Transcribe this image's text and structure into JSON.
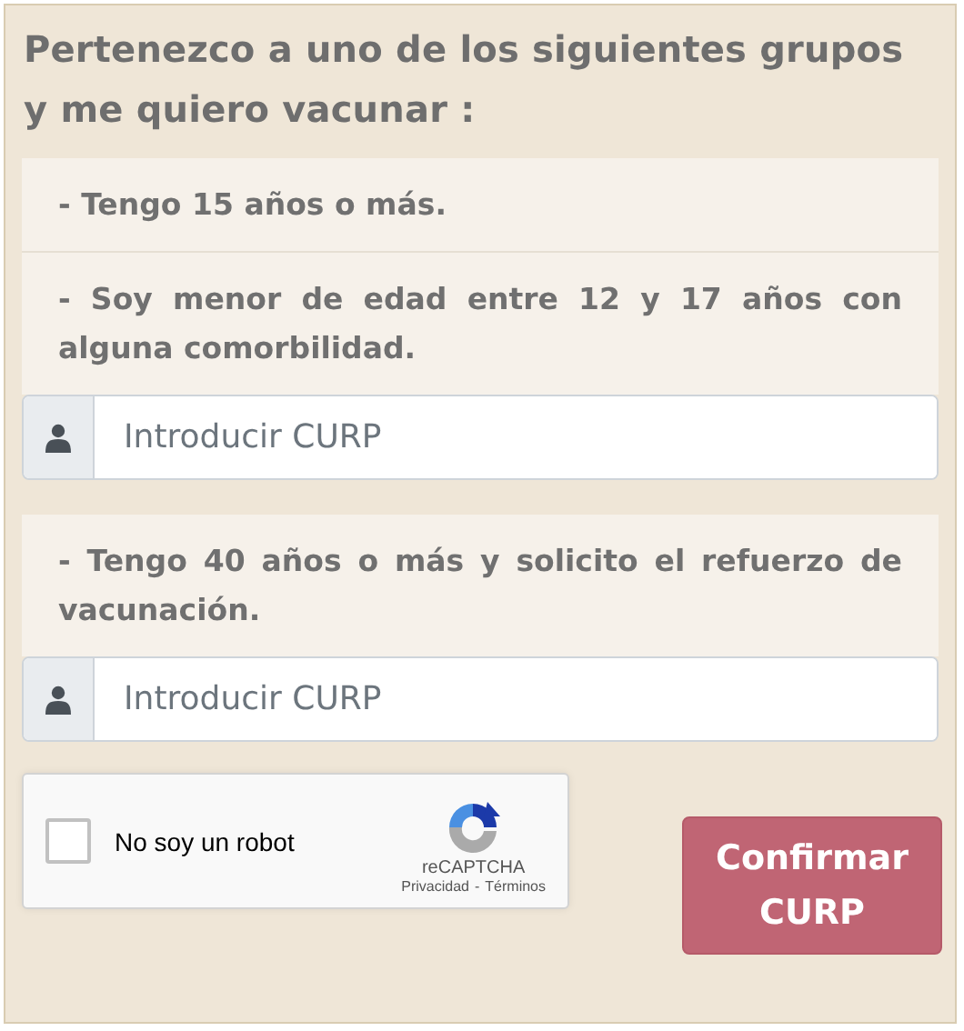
{
  "title": "Pertenezco a uno de los siguientes grupos y me quiero vacunar :",
  "groups": [
    {
      "items": [
        "- Tengo 15 años o más.",
        "- Soy menor de edad entre 12 y 17 años con alguna comorbilidad."
      ],
      "curp_field": {
        "placeholder": "Introducir CURP"
      }
    },
    {
      "items": [
        "- Tengo 40 años o más y solicito el refuerzo de vacunación."
      ],
      "curp_field": {
        "placeholder": "Introducir CURP"
      }
    }
  ],
  "captcha": {
    "label": "No soy un robot",
    "checked": false,
    "brand": "reCAPTCHA",
    "privacy_link": "Privacidad",
    "separator": "-",
    "terms_link": "Términos"
  },
  "confirm_button": "Confirmar CURP"
}
